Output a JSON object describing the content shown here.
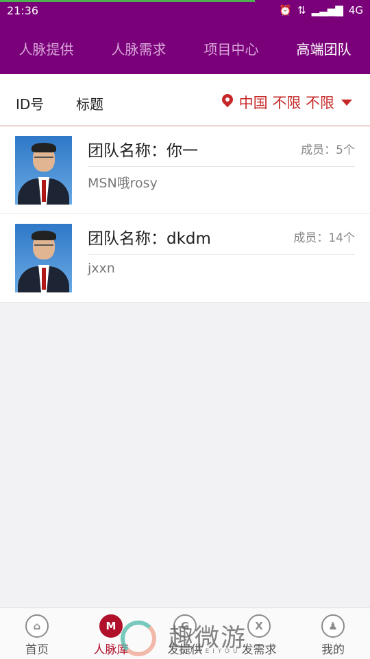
{
  "status_bar": {
    "time": "21:36",
    "network": "4G"
  },
  "tabs": [
    {
      "label": "人脉提供",
      "active": false
    },
    {
      "label": "人脉需求",
      "active": false
    },
    {
      "label": "项目中心",
      "active": false
    },
    {
      "label": "高端团队",
      "active": true
    }
  ],
  "filter": {
    "id_label": "ID号",
    "title_label": "标题",
    "location": "中国 不限 不限"
  },
  "teams": [
    {
      "title": "团队名称：你一",
      "members": "成员：5个",
      "desc": "MSN哦rosy"
    },
    {
      "title": "团队名称：dkdm",
      "members": "成员：14个",
      "desc": "jxxn"
    }
  ],
  "bottom_nav": [
    {
      "label": "首页",
      "icon": "home-icon",
      "glyph": "⌂",
      "active": false
    },
    {
      "label": "人脉库",
      "icon": "contacts-icon",
      "glyph": "M",
      "active": true
    },
    {
      "label": "发提供",
      "icon": "offer-icon",
      "glyph": "G",
      "active": false
    },
    {
      "label": "发需求",
      "icon": "request-icon",
      "glyph": "X",
      "active": false
    },
    {
      "label": "我的",
      "icon": "profile-icon",
      "glyph": "♟",
      "active": false
    }
  ],
  "watermark": {
    "text": "趣微游",
    "sub": "QUWEIYOU"
  },
  "colors": {
    "header_purple": "#7a007a",
    "accent_red": "#c62828",
    "active_nav": "#b0102a"
  }
}
